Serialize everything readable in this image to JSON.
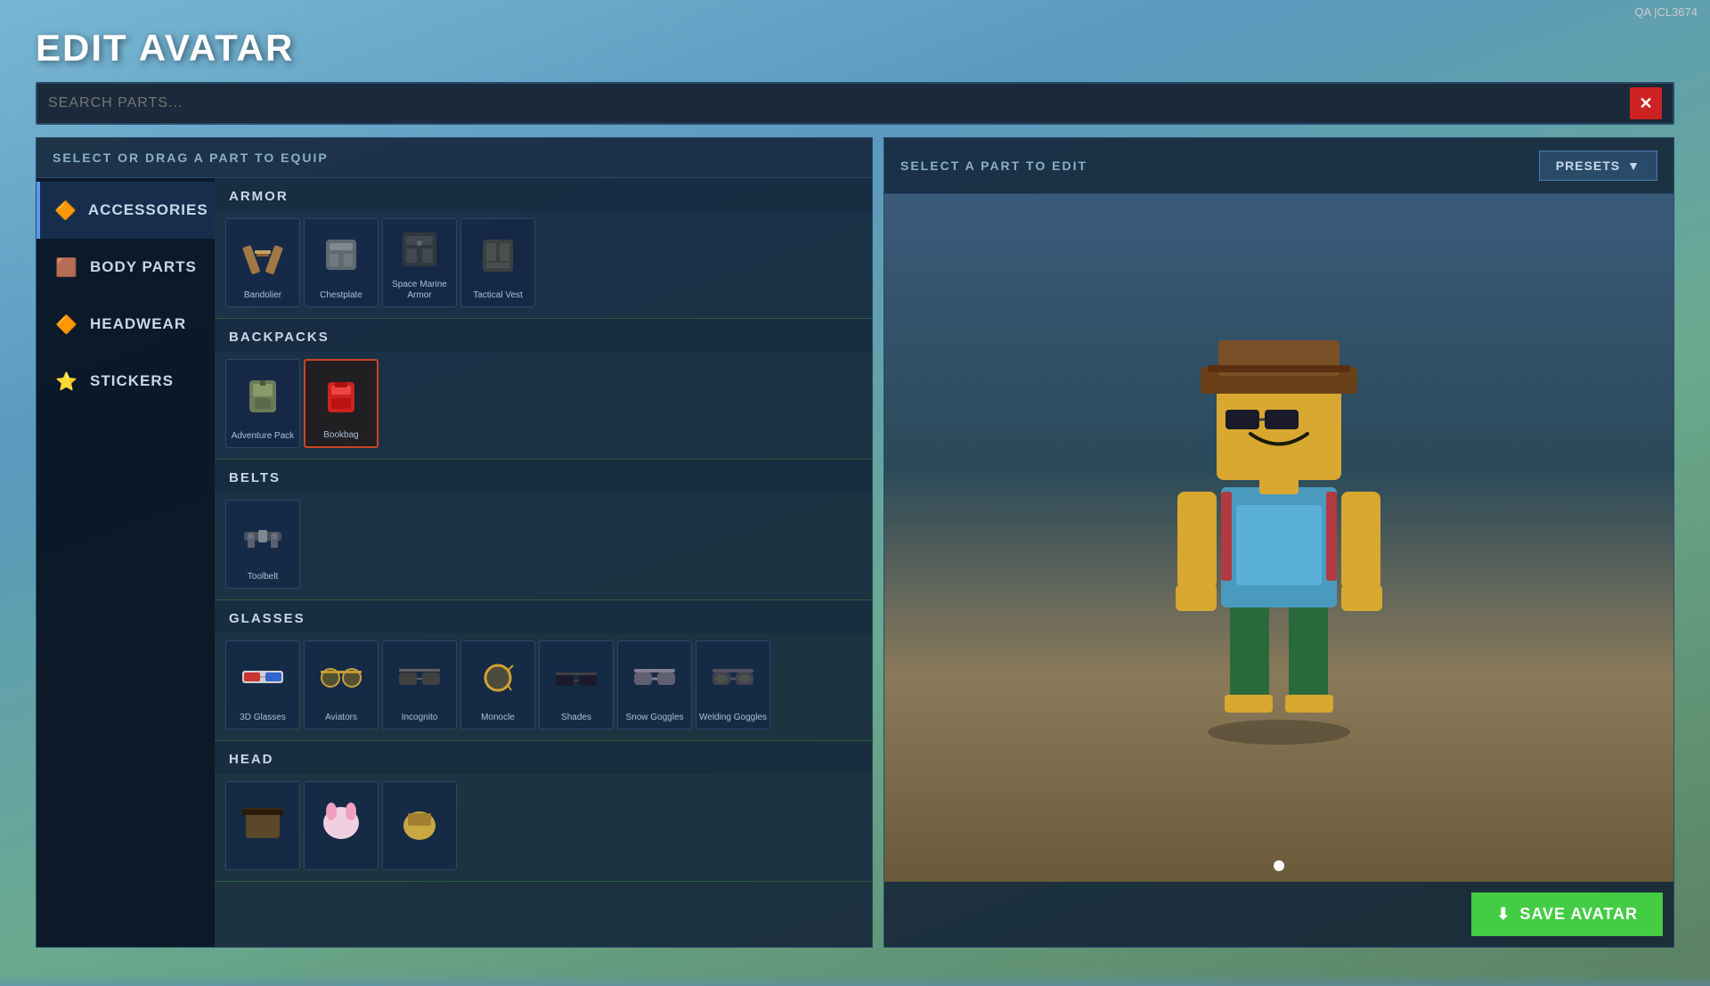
{
  "topbar": {
    "label": "QA |CL3674"
  },
  "title": "EDIT AVATAR",
  "search": {
    "placeholder": "SEARCH PARTS...",
    "value": ""
  },
  "left_panel": {
    "header": "SELECT OR DRAG A PART TO EQUIP",
    "sidebar": {
      "items": [
        {
          "id": "accessories",
          "label": "Accessories",
          "icon": "🔶",
          "active": true
        },
        {
          "id": "body-parts",
          "label": "Body Parts",
          "icon": "🟫",
          "active": false
        },
        {
          "id": "headwear",
          "label": "Headwear",
          "icon": "🔶",
          "active": false
        },
        {
          "id": "stickers",
          "label": "Stickers",
          "icon": "⭐",
          "active": false
        }
      ]
    },
    "categories": [
      {
        "id": "armor",
        "label": "Armor",
        "items": [
          {
            "id": "bandolier",
            "label": "Bandolier",
            "emoji": "🎖️"
          },
          {
            "id": "chestplate",
            "label": "Chestplate",
            "emoji": "🛡️"
          },
          {
            "id": "space-marine-armor",
            "label": "Space Marine Armor",
            "emoji": "🔲"
          },
          {
            "id": "tactical-vest",
            "label": "Tactical Vest",
            "emoji": "🔳"
          }
        ]
      },
      {
        "id": "backpacks",
        "label": "Backpacks",
        "items": [
          {
            "id": "adventure-pack",
            "label": "Adventure Pack",
            "emoji": "🎒",
            "selected": false
          },
          {
            "id": "bookbag",
            "label": "Bookbag",
            "emoji": "🎒",
            "selected": true
          }
        ]
      },
      {
        "id": "belts",
        "label": "Belts",
        "items": [
          {
            "id": "toolbelt",
            "label": "Toolbelt",
            "emoji": "🔧"
          }
        ]
      },
      {
        "id": "glasses",
        "label": "Glasses",
        "items": [
          {
            "id": "3d-glasses",
            "label": "3D Glasses",
            "emoji": "🥽"
          },
          {
            "id": "aviators",
            "label": "Aviators",
            "emoji": "🕶️"
          },
          {
            "id": "incognito",
            "label": "Incognito",
            "emoji": "🕶️"
          },
          {
            "id": "monocle",
            "label": "Monocle",
            "emoji": "🔍"
          },
          {
            "id": "shades",
            "label": "Shades",
            "emoji": "🕶️"
          },
          {
            "id": "snow-goggles",
            "label": "Snow Goggles",
            "emoji": "🥽"
          },
          {
            "id": "welding-goggles",
            "label": "Welding Goggles",
            "emoji": "🥽"
          }
        ]
      },
      {
        "id": "head",
        "label": "Head",
        "items": [
          {
            "id": "head-1",
            "label": "",
            "emoji": "😎"
          },
          {
            "id": "head-2",
            "label": "",
            "emoji": "🐰"
          },
          {
            "id": "head-3",
            "label": "",
            "emoji": "😄"
          }
        ]
      }
    ]
  },
  "right_panel": {
    "header": "SELECT A PART TO EDIT",
    "presets_label": "PRESETS",
    "save_label": "SAVE AVATAR",
    "save_icon": "⬇",
    "dot_active": 0
  }
}
